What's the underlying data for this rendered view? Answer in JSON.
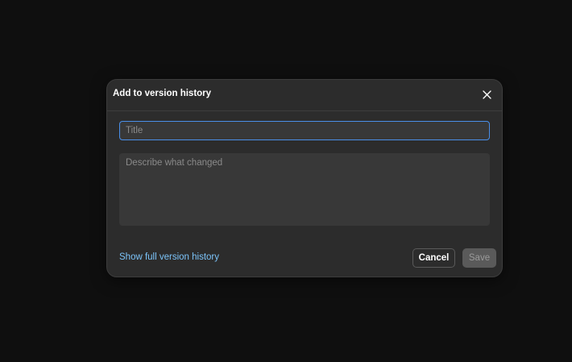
{
  "dialog": {
    "title": "Add to version history",
    "close_icon": "close-icon",
    "title_field": {
      "value": "",
      "placeholder": "Title"
    },
    "description_field": {
      "value": "",
      "placeholder": "Describe what changed"
    },
    "history_link": "Show full version history",
    "cancel_label": "Cancel",
    "save_label": "Save"
  },
  "colors": {
    "background": "#0f0f0f",
    "dialog_background": "#2c2c2c",
    "focus_accent": "#4a8fe8",
    "link": "#7cc4fa",
    "save_disabled_background": "#5a5a5a"
  }
}
